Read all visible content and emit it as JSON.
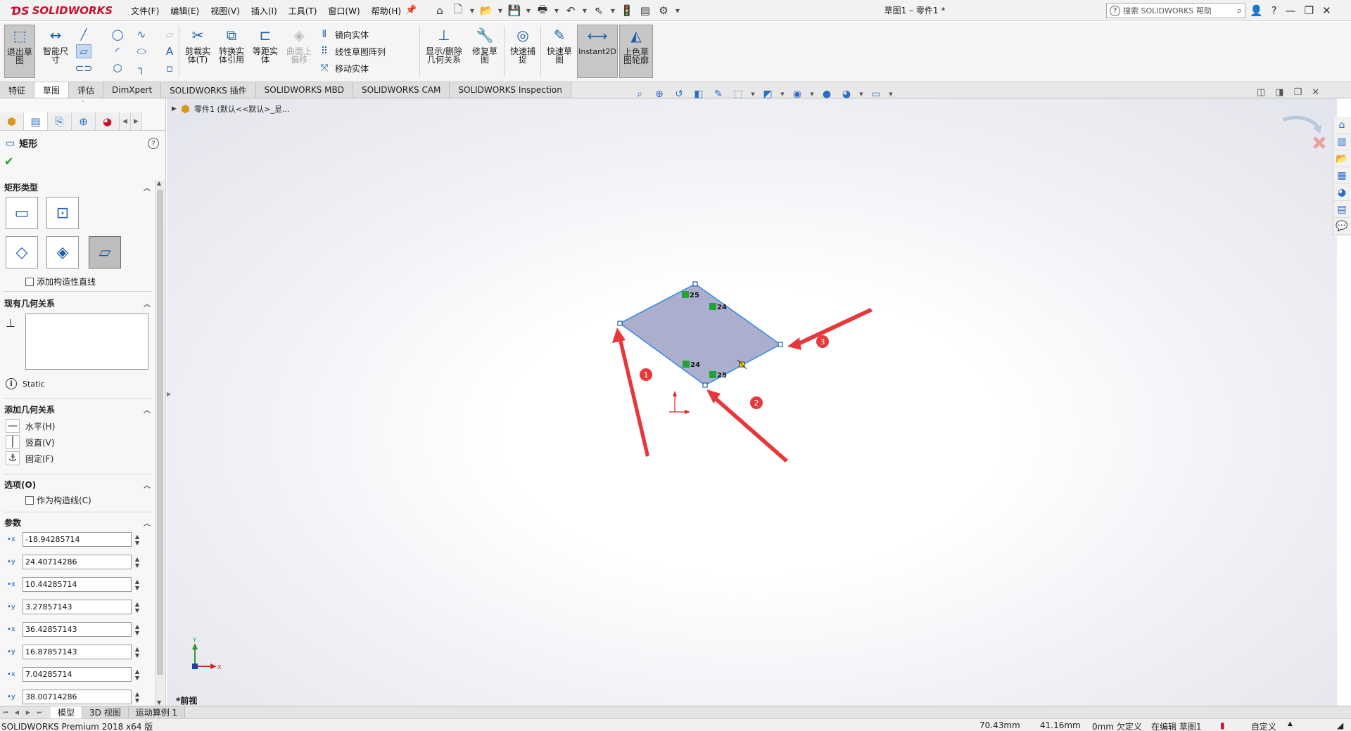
{
  "app": {
    "logo_text": "SOLIDWORKS",
    "document_title": "草图1 – 零件1 *",
    "menus": [
      "文件(F)",
      "编辑(E)",
      "视图(V)",
      "插入(I)",
      "工具(T)",
      "窗口(W)",
      "帮助(H)"
    ],
    "help_search_placeholder": "搜索 SOLIDWORKS 帮助"
  },
  "commands": {
    "exit_sketch": "退出草图",
    "smart_dim": "智能尺寸",
    "trim": "剪裁实体(T)",
    "convert": "转换实体引用",
    "offset": "等距实体",
    "surface_offset": "曲面上偏移",
    "mirror": "镜向实体",
    "linear_pattern": "线性草图阵列",
    "move": "移动实体",
    "show_delete_relations": "显示/删除几何关系",
    "repair": "修复草图",
    "quick_snaps": "快速捕捉",
    "rapid_sketch": "快速草图",
    "instant2d": "Instant2D",
    "shaded_contours": "上色草图轮廓"
  },
  "tabs": [
    "特征",
    "草图",
    "评估",
    "DimXpert",
    "SOLIDWORKS 插件",
    "SOLIDWORKS MBD",
    "SOLIDWORKS CAM",
    "SOLIDWORKS Inspection"
  ],
  "active_tab": "草图",
  "property_manager": {
    "title": "矩形",
    "sections": {
      "rect_type": "矩形类型",
      "existing_relations": "现有几何关系",
      "add_relations": "添加几何关系",
      "options": "选项(O)",
      "parameters": "参数"
    },
    "add_construction_lines": "添加构造性直线",
    "status": "Static",
    "relations": [
      "水平(H)",
      "竖直(V)",
      "固定(F)"
    ],
    "for_construction": "作为构造线(C)",
    "params": [
      {
        "axis": "x",
        "value": "-18.94285714"
      },
      {
        "axis": "y",
        "value": "24.40714286"
      },
      {
        "axis": "x",
        "value": "10.44285714"
      },
      {
        "axis": "y",
        "value": "3.27857143"
      },
      {
        "axis": "x",
        "value": "36.42857143"
      },
      {
        "axis": "y",
        "value": "16.87857143"
      },
      {
        "axis": "x",
        "value": "7.04285714"
      },
      {
        "axis": "y",
        "value": "38.00714286"
      }
    ]
  },
  "graphics": {
    "tree_item": "零件1 (默认<<默认>_显...",
    "view_name": "*前视",
    "sketch": {
      "relation_tags": [
        "25",
        "24",
        "24",
        "25"
      ],
      "callouts": [
        "1",
        "2",
        "3"
      ]
    },
    "triad_axes": [
      "Y",
      "X"
    ]
  },
  "bottom_tabs": [
    "模型",
    "3D 视图",
    "运动算例 1"
  ],
  "status_bar": {
    "product": "SOLIDWORKS Premium 2018 x64 版",
    "x": "70.43mm",
    "y": "41.16mm",
    "z": "0mm 欠定义",
    "mode": "在编辑 草图1",
    "units": "自定义"
  },
  "colors": {
    "accent": "#1f5fa8",
    "sketch_line": "#3c8ce6",
    "sketch_fill": "#9ea0c4",
    "arrow_red": "#e8373a",
    "relation_green": "#21a33a"
  }
}
